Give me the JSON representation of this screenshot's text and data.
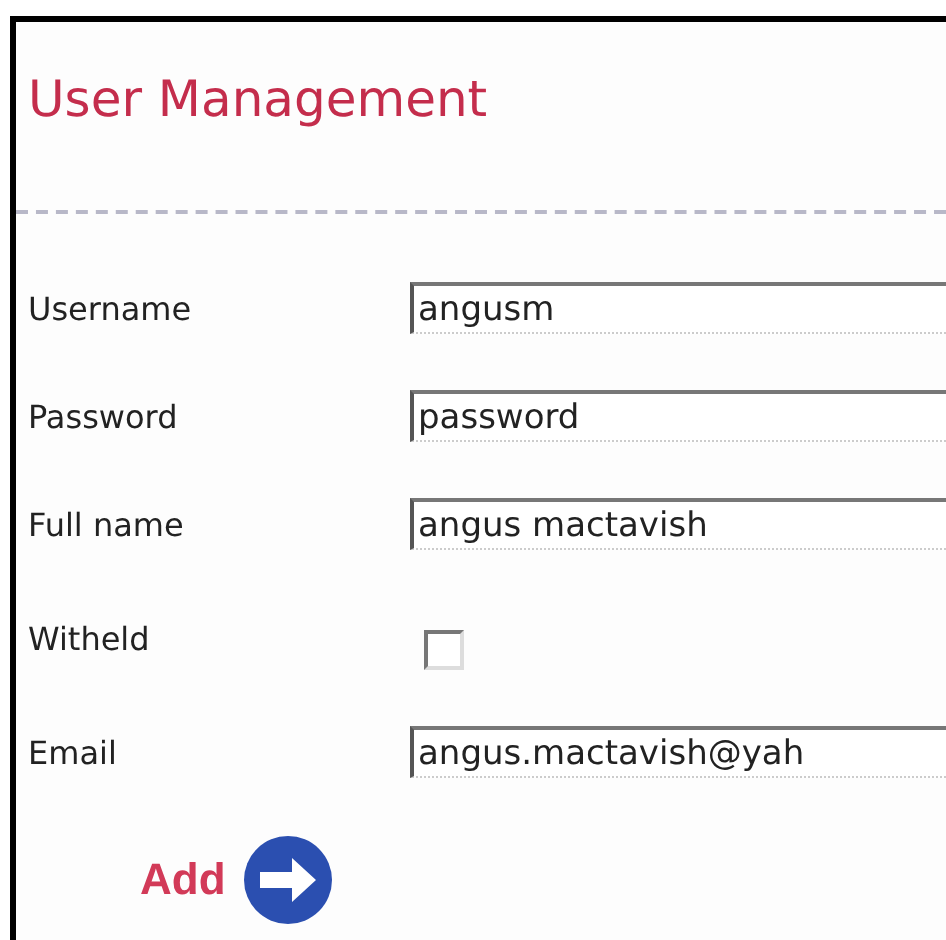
{
  "title": "User Management",
  "fields": [
    {
      "kind": "text",
      "label": "Username",
      "value": "angusm"
    },
    {
      "kind": "text",
      "label": "Password",
      "value": "password"
    },
    {
      "kind": "text",
      "label": "Full name",
      "value": "angus mactavish"
    },
    {
      "kind": "checkbox",
      "label": "Witheld",
      "checked": false
    },
    {
      "kind": "text",
      "label": "Email",
      "value": "angus.mactavish@yah"
    }
  ],
  "submit": {
    "label": "Add"
  }
}
